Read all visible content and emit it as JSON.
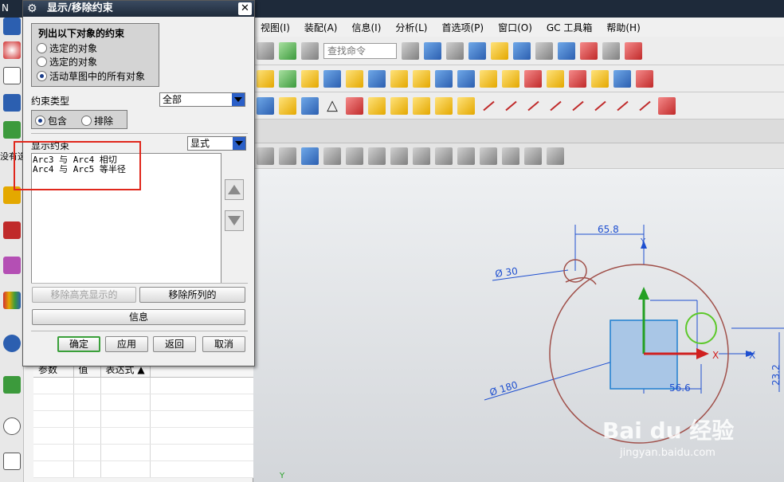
{
  "app": {
    "title_fragment": "N"
  },
  "menu": [
    {
      "label": "视图(I)"
    },
    {
      "label": "装配(A)"
    },
    {
      "label": "信息(I)"
    },
    {
      "label": "分析(L)"
    },
    {
      "label": "首选项(P)"
    },
    {
      "label": "窗口(O)"
    },
    {
      "label": "GC 工具箱"
    },
    {
      "label": "帮助(H)"
    }
  ],
  "toolbar": {
    "search_placeholder": "查找命令"
  },
  "dialog": {
    "title": "显示/移除约束",
    "list_group_title": "列出以下对象的约束",
    "list_options": [
      {
        "label": "选定的对象",
        "selected": false
      },
      {
        "label": "选定的对象",
        "selected": false
      },
      {
        "label": "活动草图中的所有对象",
        "selected": true
      }
    ],
    "constraint_type_label": "约束类型",
    "constraint_type_value": "全部",
    "mode_options": [
      {
        "label": "包含",
        "selected": true
      },
      {
        "label": "排除",
        "selected": false
      }
    ],
    "show_constraints_label": "显示约束",
    "show_mode_value": "显式",
    "constraints": [
      "Arc3 与 Arc4 相切",
      "Arc4 与 Arc5 等半径"
    ],
    "remove_highlighted_label": "移除高亮显示的",
    "remove_listed_label": "移除所列的",
    "info_label": "信息",
    "ok_label": "确定",
    "apply_label": "应用",
    "back_label": "返回",
    "cancel_label": "取消"
  },
  "left_strip": {
    "partial_label": "没有选"
  },
  "nav_table": {
    "columns": [
      "参数",
      "值",
      "表达式 ▲"
    ]
  },
  "sketch": {
    "dim_top": "65.8",
    "dim_small_circle": "Ø 30",
    "dim_big_circle": "Ø 180",
    "dim_bottom": "56.6",
    "dim_right": "23.2",
    "axis_x": "X",
    "axis_y": "Y"
  },
  "watermark": {
    "brand": "Bai du 经验",
    "url": "jingyan.baidu.com"
  },
  "colors": {
    "annotation": "#e0271c",
    "sketch_curve": "#a0504a",
    "dimension": "#1e4fd0",
    "axis_green": "#23a023",
    "axis_red": "#d02020"
  }
}
